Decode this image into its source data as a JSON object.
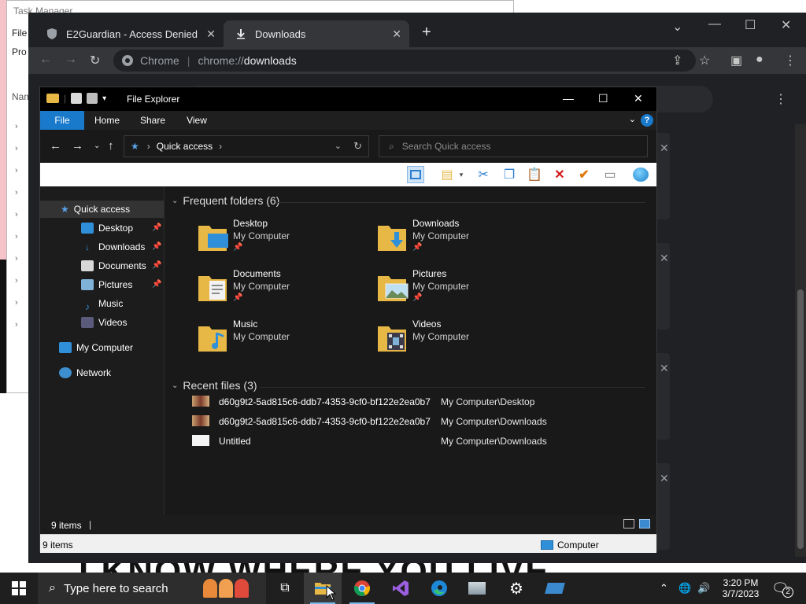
{
  "background": {
    "task_manager": {
      "title": "Task Manager",
      "menu_file": "File",
      "tab_processes": "Pro",
      "col_name": "Nam"
    },
    "poster_text": "I KNOW WHERE YOU LIVE"
  },
  "chrome": {
    "tabs": [
      {
        "label": "E2Guardian - Access Denied"
      },
      {
        "label": "Downloads"
      }
    ],
    "new_tab": "+",
    "window_controls": {
      "collapse": "⌄",
      "minimize": "—",
      "maximize": "☐",
      "close": "✕"
    },
    "address": {
      "scheme_label": "Chrome",
      "url_prefix": "chrome://",
      "url_bold": "downloads"
    },
    "icons": [
      "back-icon",
      "forward-icon",
      "reload-icon",
      "share-icon",
      "bookmark-star-icon",
      "side-panel-icon",
      "profile-icon",
      "menu-icon"
    ]
  },
  "explorer": {
    "title": "File Explorer",
    "ribbon_tabs": [
      "File",
      "Home",
      "Share",
      "View"
    ],
    "help": "?",
    "address": {
      "location": "Quick access"
    },
    "search_placeholder": "Search Quick access",
    "nav": {
      "quick_access": "Quick access",
      "items": [
        {
          "label": "Desktop",
          "pinned": true
        },
        {
          "label": "Downloads",
          "pinned": true
        },
        {
          "label": "Documents",
          "pinned": true
        },
        {
          "label": "Pictures",
          "pinned": true
        },
        {
          "label": "Music",
          "pinned": false
        },
        {
          "label": "Videos",
          "pinned": false
        }
      ],
      "my_computer": "My Computer",
      "network": "Network"
    },
    "frequent_header": "Frequent folders (6)",
    "frequent": [
      {
        "name": "Desktop",
        "location": "My Computer",
        "pinned": true
      },
      {
        "name": "Downloads",
        "location": "My Computer",
        "pinned": true
      },
      {
        "name": "Documents",
        "location": "My Computer",
        "pinned": true
      },
      {
        "name": "Pictures",
        "location": "My Computer",
        "pinned": true
      },
      {
        "name": "Music",
        "location": "My Computer",
        "pinned": false
      },
      {
        "name": "Videos",
        "location": "My Computer",
        "pinned": false
      }
    ],
    "recent_header": "Recent files (3)",
    "recent": [
      {
        "name": "d60g9t2-5ad815c6-ddb7-4353-9cf0-bf122e2ea0b7",
        "path": "My Computer\\Desktop"
      },
      {
        "name": "d60g9t2-5ad815c6-ddb7-4353-9cf0-bf122e2ea0b7",
        "path": "My Computer\\Downloads"
      },
      {
        "name": "Untitled",
        "path": "My Computer\\Downloads"
      }
    ],
    "status_count": "9 items",
    "status_bar_sep": "|",
    "status2_count": "9 items",
    "status2_location": "Computer"
  },
  "taskbar": {
    "search_placeholder": "Type here to search",
    "time": "3:20 PM",
    "date": "3/7/2023",
    "notification_count": "2"
  }
}
